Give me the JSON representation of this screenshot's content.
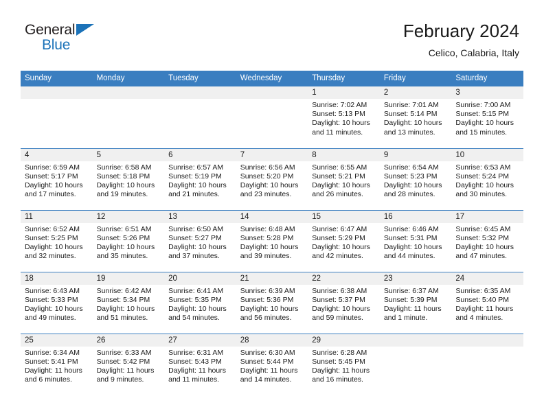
{
  "brand": {
    "name_top": "General",
    "name_bottom": "Blue",
    "triangle_icon": "triangle-icon",
    "color_black": "#231f20",
    "color_blue": "#1b72b8"
  },
  "header": {
    "title": "February 2024",
    "subtitle": "Celico, Calabria, Italy"
  },
  "theme": {
    "header_blue": "#3a7ec0",
    "date_band_gray": "#f0f0f0",
    "cell_white": "#ffffff",
    "text": "#1a1a1a"
  },
  "calendar": {
    "weekdays": [
      "Sunday",
      "Monday",
      "Tuesday",
      "Wednesday",
      "Thursday",
      "Friday",
      "Saturday"
    ],
    "weeks": [
      [
        {
          "day": "",
          "lines": []
        },
        {
          "day": "",
          "lines": []
        },
        {
          "day": "",
          "lines": []
        },
        {
          "day": "",
          "lines": []
        },
        {
          "day": "1",
          "lines": [
            "Sunrise: 7:02 AM",
            "Sunset: 5:13 PM",
            "Daylight: 10 hours",
            "and 11 minutes."
          ]
        },
        {
          "day": "2",
          "lines": [
            "Sunrise: 7:01 AM",
            "Sunset: 5:14 PM",
            "Daylight: 10 hours",
            "and 13 minutes."
          ]
        },
        {
          "day": "3",
          "lines": [
            "Sunrise: 7:00 AM",
            "Sunset: 5:15 PM",
            "Daylight: 10 hours",
            "and 15 minutes."
          ]
        }
      ],
      [
        {
          "day": "4",
          "lines": [
            "Sunrise: 6:59 AM",
            "Sunset: 5:17 PM",
            "Daylight: 10 hours",
            "and 17 minutes."
          ]
        },
        {
          "day": "5",
          "lines": [
            "Sunrise: 6:58 AM",
            "Sunset: 5:18 PM",
            "Daylight: 10 hours",
            "and 19 minutes."
          ]
        },
        {
          "day": "6",
          "lines": [
            "Sunrise: 6:57 AM",
            "Sunset: 5:19 PM",
            "Daylight: 10 hours",
            "and 21 minutes."
          ]
        },
        {
          "day": "7",
          "lines": [
            "Sunrise: 6:56 AM",
            "Sunset: 5:20 PM",
            "Daylight: 10 hours",
            "and 23 minutes."
          ]
        },
        {
          "day": "8",
          "lines": [
            "Sunrise: 6:55 AM",
            "Sunset: 5:21 PM",
            "Daylight: 10 hours",
            "and 26 minutes."
          ]
        },
        {
          "day": "9",
          "lines": [
            "Sunrise: 6:54 AM",
            "Sunset: 5:23 PM",
            "Daylight: 10 hours",
            "and 28 minutes."
          ]
        },
        {
          "day": "10",
          "lines": [
            "Sunrise: 6:53 AM",
            "Sunset: 5:24 PM",
            "Daylight: 10 hours",
            "and 30 minutes."
          ]
        }
      ],
      [
        {
          "day": "11",
          "lines": [
            "Sunrise: 6:52 AM",
            "Sunset: 5:25 PM",
            "Daylight: 10 hours",
            "and 32 minutes."
          ]
        },
        {
          "day": "12",
          "lines": [
            "Sunrise: 6:51 AM",
            "Sunset: 5:26 PM",
            "Daylight: 10 hours",
            "and 35 minutes."
          ]
        },
        {
          "day": "13",
          "lines": [
            "Sunrise: 6:50 AM",
            "Sunset: 5:27 PM",
            "Daylight: 10 hours",
            "and 37 minutes."
          ]
        },
        {
          "day": "14",
          "lines": [
            "Sunrise: 6:48 AM",
            "Sunset: 5:28 PM",
            "Daylight: 10 hours",
            "and 39 minutes."
          ]
        },
        {
          "day": "15",
          "lines": [
            "Sunrise: 6:47 AM",
            "Sunset: 5:29 PM",
            "Daylight: 10 hours",
            "and 42 minutes."
          ]
        },
        {
          "day": "16",
          "lines": [
            "Sunrise: 6:46 AM",
            "Sunset: 5:31 PM",
            "Daylight: 10 hours",
            "and 44 minutes."
          ]
        },
        {
          "day": "17",
          "lines": [
            "Sunrise: 6:45 AM",
            "Sunset: 5:32 PM",
            "Daylight: 10 hours",
            "and 47 minutes."
          ]
        }
      ],
      [
        {
          "day": "18",
          "lines": [
            "Sunrise: 6:43 AM",
            "Sunset: 5:33 PM",
            "Daylight: 10 hours",
            "and 49 minutes."
          ]
        },
        {
          "day": "19",
          "lines": [
            "Sunrise: 6:42 AM",
            "Sunset: 5:34 PM",
            "Daylight: 10 hours",
            "and 51 minutes."
          ]
        },
        {
          "day": "20",
          "lines": [
            "Sunrise: 6:41 AM",
            "Sunset: 5:35 PM",
            "Daylight: 10 hours",
            "and 54 minutes."
          ]
        },
        {
          "day": "21",
          "lines": [
            "Sunrise: 6:39 AM",
            "Sunset: 5:36 PM",
            "Daylight: 10 hours",
            "and 56 minutes."
          ]
        },
        {
          "day": "22",
          "lines": [
            "Sunrise: 6:38 AM",
            "Sunset: 5:37 PM",
            "Daylight: 10 hours",
            "and 59 minutes."
          ]
        },
        {
          "day": "23",
          "lines": [
            "Sunrise: 6:37 AM",
            "Sunset: 5:39 PM",
            "Daylight: 11 hours",
            "and 1 minute."
          ]
        },
        {
          "day": "24",
          "lines": [
            "Sunrise: 6:35 AM",
            "Sunset: 5:40 PM",
            "Daylight: 11 hours",
            "and 4 minutes."
          ]
        }
      ],
      [
        {
          "day": "25",
          "lines": [
            "Sunrise: 6:34 AM",
            "Sunset: 5:41 PM",
            "Daylight: 11 hours",
            "and 6 minutes."
          ]
        },
        {
          "day": "26",
          "lines": [
            "Sunrise: 6:33 AM",
            "Sunset: 5:42 PM",
            "Daylight: 11 hours",
            "and 9 minutes."
          ]
        },
        {
          "day": "27",
          "lines": [
            "Sunrise: 6:31 AM",
            "Sunset: 5:43 PM",
            "Daylight: 11 hours",
            "and 11 minutes."
          ]
        },
        {
          "day": "28",
          "lines": [
            "Sunrise: 6:30 AM",
            "Sunset: 5:44 PM",
            "Daylight: 11 hours",
            "and 14 minutes."
          ]
        },
        {
          "day": "29",
          "lines": [
            "Sunrise: 6:28 AM",
            "Sunset: 5:45 PM",
            "Daylight: 11 hours",
            "and 16 minutes."
          ]
        },
        {
          "day": "",
          "lines": []
        },
        {
          "day": "",
          "lines": []
        }
      ]
    ]
  }
}
